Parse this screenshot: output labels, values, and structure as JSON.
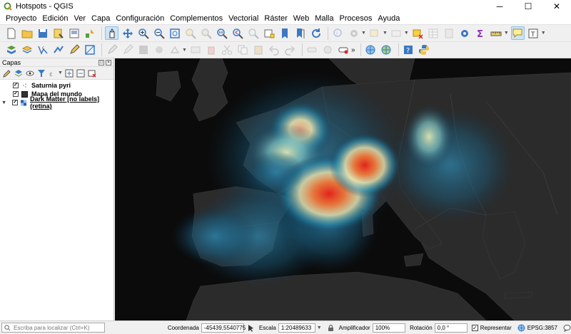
{
  "window": {
    "title": "Hotspots - QGIS"
  },
  "menu": [
    "Proyecto",
    "Edición",
    "Ver",
    "Capa",
    "Configuración",
    "Complementos",
    "Vectorial",
    "Ráster",
    "Web",
    "Malla",
    "Procesos",
    "Ayuda"
  ],
  "layers_panel": {
    "title": "Capas",
    "layers": [
      {
        "name": "Saturnia pyri",
        "checked": true
      },
      {
        "name": "Mapa del mundo",
        "checked": true
      },
      {
        "name": "Dark Matter [no labels] (retina)",
        "checked": true,
        "selected": true
      }
    ]
  },
  "statusbar": {
    "locator_placeholder": "Escriba para localizar (Ctrl+K)",
    "coordinate_label": "Coordenada",
    "coordinate_value": "-45439,5540775",
    "scale_label": "Escala",
    "scale_value": "1:20489633",
    "magnifier_label": "Amplificador",
    "magnifier_value": "100%",
    "rotation_label": "Rotación",
    "rotation_value": "0,0 °",
    "render_label": "Representar",
    "crs_label": "EPSG:3857"
  },
  "colors": {
    "map_background": "#0b0b0b",
    "land": "#2b2b2b",
    "heat_low": "#1b6d8f",
    "heat_mid": "#f2e8b0",
    "heat_high": "#e3231a"
  }
}
